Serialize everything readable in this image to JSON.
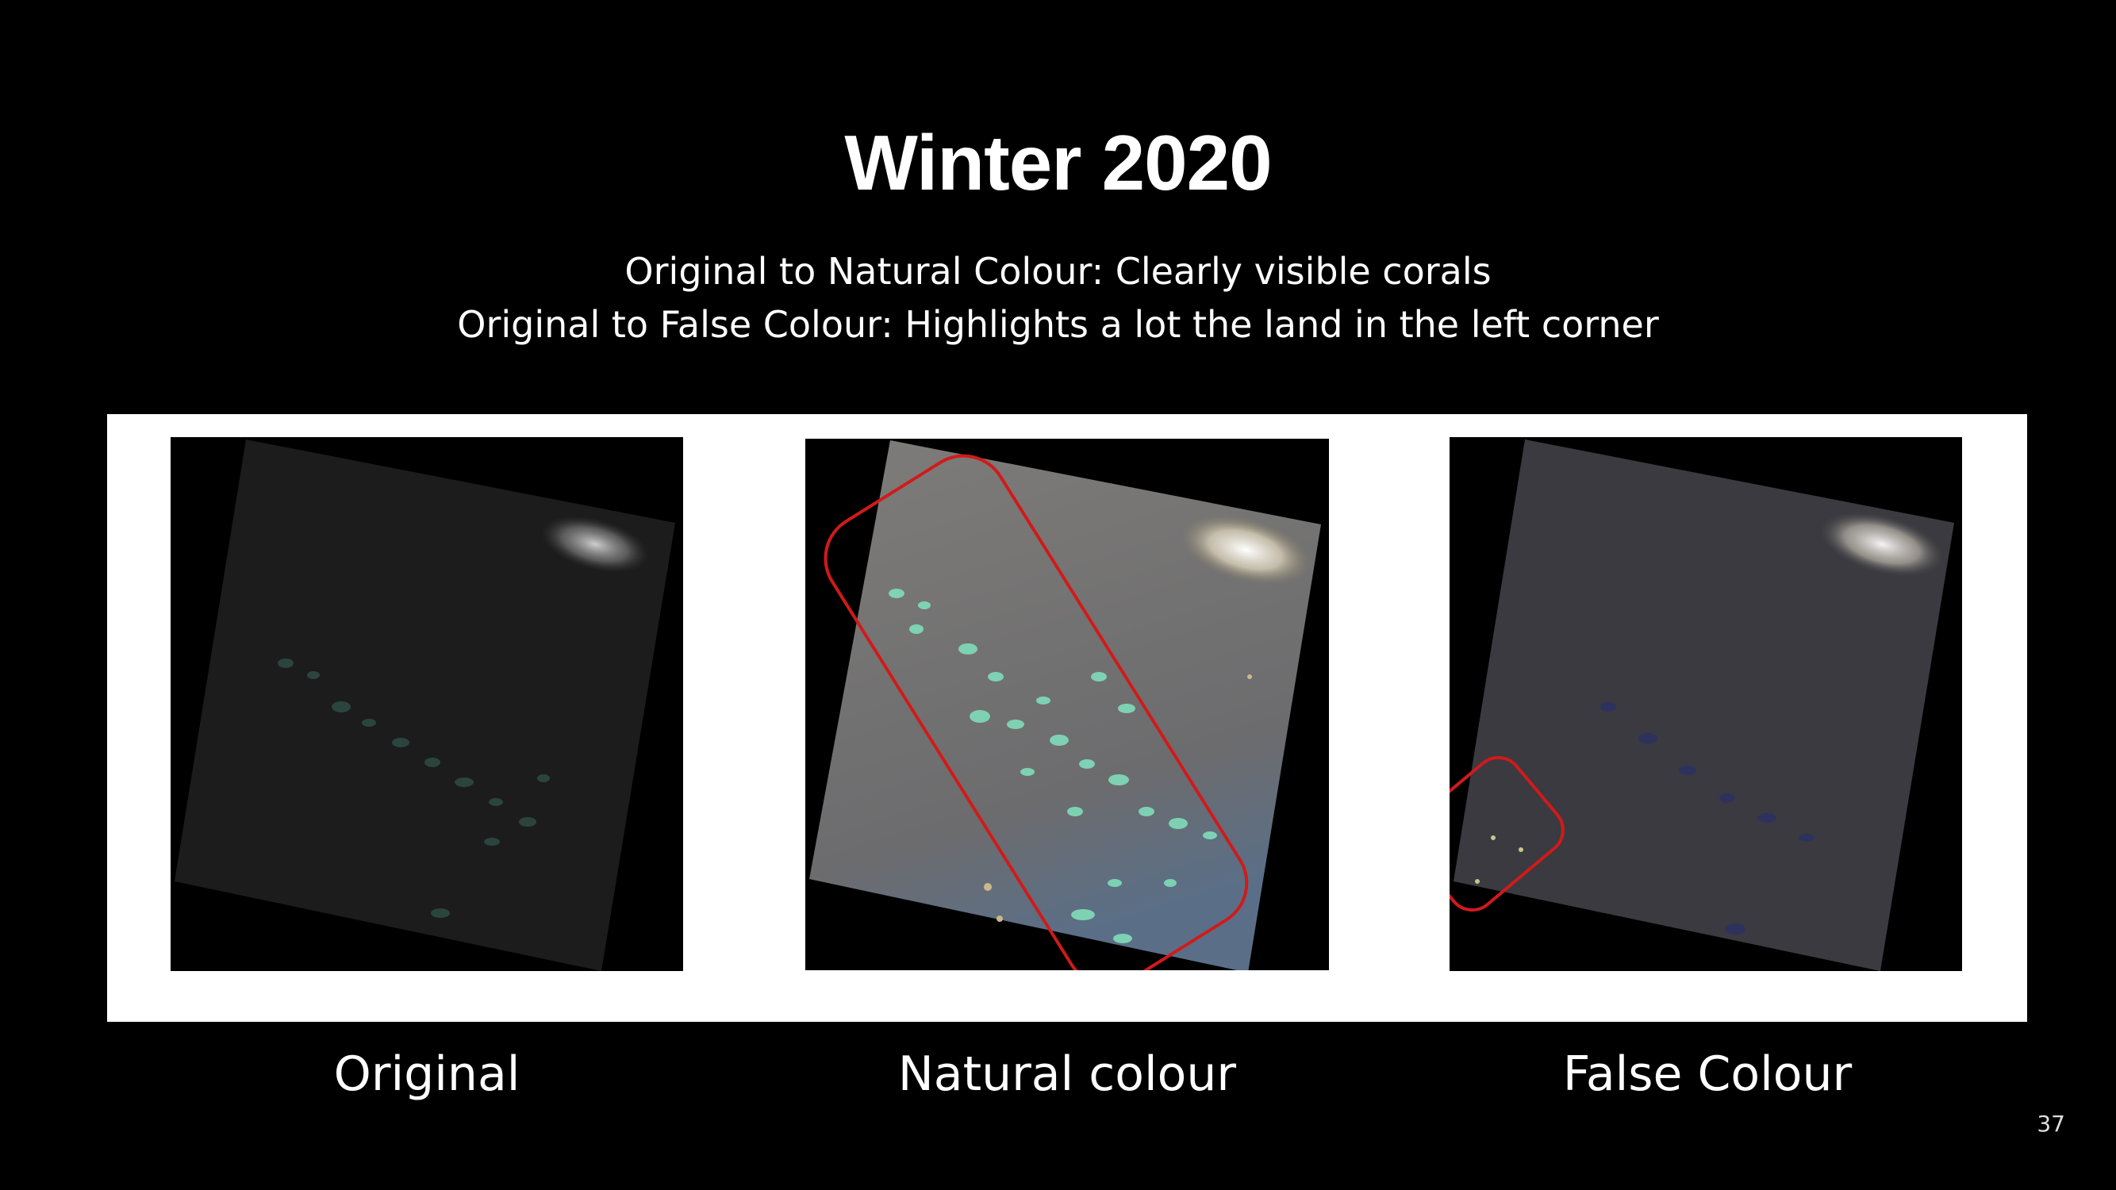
{
  "slide": {
    "title": "Winter 2020",
    "subtitle_lines": [
      "Original to Natural Colour: Clearly visible corals",
      "Original to False Colour: Highlights a lot the land in the left corner"
    ],
    "page_number": "37"
  },
  "figures": [
    {
      "caption": "Original",
      "highlight": false
    },
    {
      "caption": "Natural colour",
      "highlight": true
    },
    {
      "caption": "False Colour",
      "highlight": true
    }
  ],
  "colors": {
    "background": "#000000",
    "panel": "#ffffff",
    "highlight_outline": "#d11a1a"
  }
}
